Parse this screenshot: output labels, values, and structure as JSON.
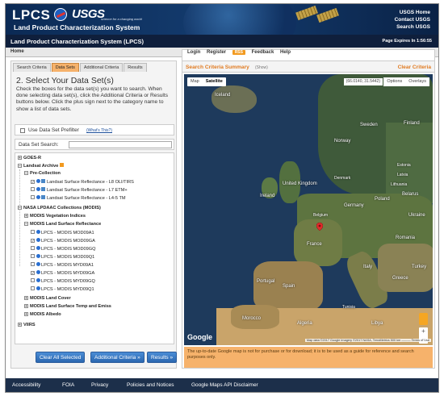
{
  "header": {
    "brand": "LPCS",
    "agency": "USGS",
    "agency_tagline": "science for a changing world",
    "subtitle": "Land Product Characterization System",
    "links": [
      "USGS Home",
      "Contact USGS",
      "Search USGS"
    ],
    "title_bar": "Land Product Characterization System (LPCS)",
    "expires": "Page Expires In 1:56:55"
  },
  "navbar": {
    "home": "Home",
    "login": "Login",
    "register": "Register",
    "rss": "RSS",
    "feedback": "Feedback",
    "help": "Help"
  },
  "tabs": [
    {
      "label": "Search Criteria",
      "active": false
    },
    {
      "label": "Data Sets",
      "active": true
    },
    {
      "label": "Additional Criteria",
      "active": false
    },
    {
      "label": "Results",
      "active": false
    }
  ],
  "left": {
    "step_title": "2. Select Your Data Set(s)",
    "instructions": "Check the boxes for the data set(s) you want to search. When done selecting data set(s), click the Additional Criteria or Results buttons below. Click the plus sign next to the category name to show a list of data sets.",
    "prefilter_label": "Use Data Set Prefilter",
    "prefilter_help": "(What's This?)",
    "search_label": "Data Set Search:",
    "search_value": ""
  },
  "tree": {
    "goes": "GOES-R",
    "landsat_archive": "Landsat Archive",
    "pre_collection": "Pre-Collection",
    "l8": "Landsat Surface Reflectance - L8 OLI/TIRS",
    "l7": "Landsat Surface Reflectance - L7 ETM+",
    "l45": "Landsat Surface Reflectance - L4-5 TM",
    "nasa": "NASA LPDAAC Collections (MODIS)",
    "veg": "MODIS Vegetation Indices",
    "surf": "MODIS Land Surface Reflectance",
    "m1": "LPCS - MODIS MOD09A1",
    "m2": "LPCS - MODIS MOD09GA",
    "m3": "LPCS - MODIS MOD09GQ",
    "m4": "LPCS - MODIS MOD09Q1",
    "m5": "LPCS - MODIS MYD09A1",
    "m6": "LPCS - MODIS MYD09GA",
    "m7": "LPCS - MODIS MYD09GQ",
    "m8": "LPCS - MODIS MYD09Q1",
    "cover": "MODIS Land Cover",
    "temp": "MODIS Land Surface Temp and Emiss",
    "albedo": "MODIS Albedo",
    "viirs": "VIIRS"
  },
  "buttons": {
    "clear": "Clear All Selected",
    "additional": "Additional Criteria »",
    "results": "Results »"
  },
  "right": {
    "title": "Search Criteria Summary",
    "show": "(Show)",
    "clear": "Clear Criteria",
    "map_type": [
      "Map",
      "Satellite"
    ],
    "coords": "(66.0140, 31.5442)",
    "options": "Options",
    "overlays": "Overlays",
    "google": "Google",
    "map_data": "Map data ©2017 Google Imagery ©2017 NASA, TerraMetrics   500 km ———   Terms of Use",
    "disclaimer": "The up-to-date Google map is not for purchase or for download; it is to be used as a guide for reference and search purposes only."
  },
  "map_labels": {
    "iceland": "Iceland",
    "sweden": "Sweden",
    "finland": "Finland",
    "norway": "Norway",
    "uk": "United Kingdom",
    "ireland": "Ireland",
    "denmark": "Denmark",
    "germany": "Germany",
    "poland": "Poland",
    "belarus": "Belarus",
    "ukraine": "Ukraine",
    "france": "France",
    "spain": "Spain",
    "portugal": "Portugal",
    "italy": "Italy",
    "romania": "Romania",
    "turkey": "Turkey",
    "greece": "Greece",
    "morocco": "Morocco",
    "algeria": "Algeria",
    "tunisia": "Tunisia",
    "libya": "Libya",
    "belgium": "Belgium",
    "latvia": "Latvia",
    "estonia": "Estonia",
    "lithuania": "Lithuania"
  },
  "footer": {
    "accessibility": "Accessibility",
    "foia": "FOIA",
    "privacy": "Privacy",
    "policies": "Policies and Notices",
    "gmaps": "Google Maps API Disclaimer"
  },
  "colors": {
    "accent": "#e07b22",
    "tab_active": "#f6b26b",
    "button": "#2b67b0",
    "header": "#0b2a55"
  }
}
